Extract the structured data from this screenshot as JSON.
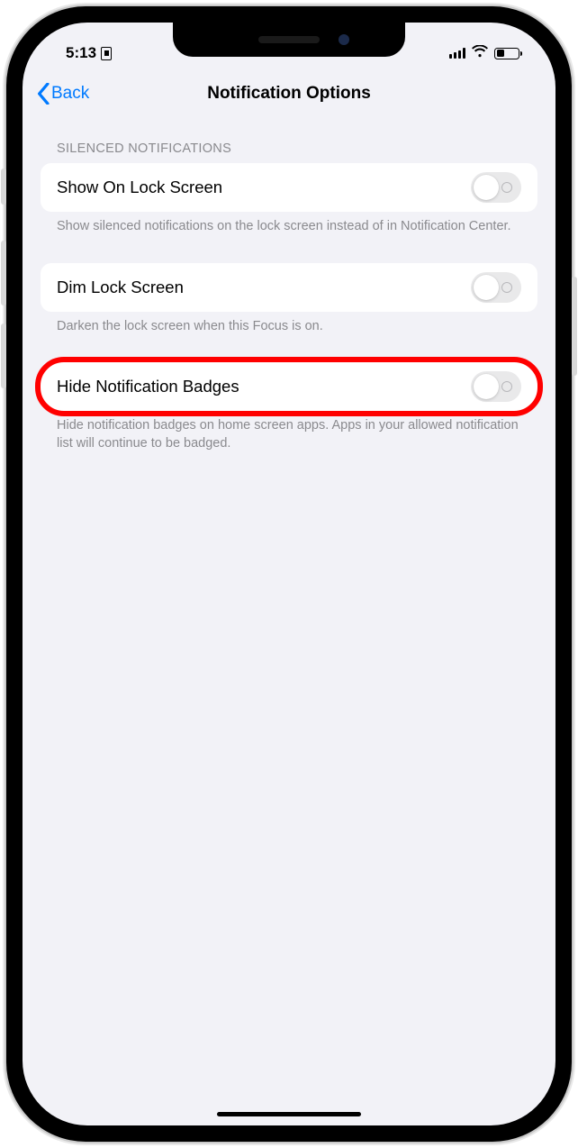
{
  "status": {
    "time": "5:13"
  },
  "nav": {
    "back_label": "Back",
    "title": "Notification Options"
  },
  "section1": {
    "header": "SILENCED NOTIFICATIONS",
    "row1": {
      "label": "Show On Lock Screen",
      "footer": "Show silenced notifications on the lock screen instead of in Notification Center."
    }
  },
  "section2": {
    "row1": {
      "label": "Dim Lock Screen",
      "footer": "Darken the lock screen when this Focus is on."
    }
  },
  "section3": {
    "row1": {
      "label": "Hide Notification Badges",
      "footer": "Hide notification badges on home screen apps. Apps in your allowed notification list will continue to be badged."
    }
  }
}
